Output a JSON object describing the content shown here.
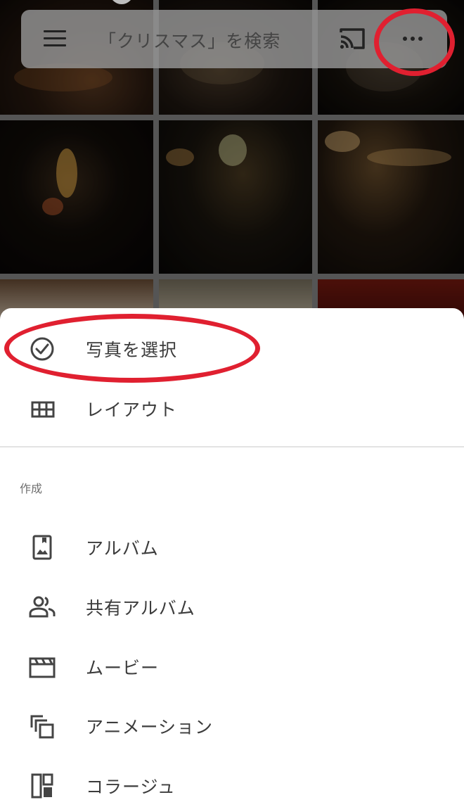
{
  "search": {
    "text": "「クリスマス」を検索"
  },
  "icons": {
    "menu": "menu-icon",
    "cast": "cast-icon",
    "more": "more-horizontal-icon"
  },
  "menu_sheet": {
    "items_top": [
      {
        "label": "写真を選択",
        "icon": "check-circle-icon"
      },
      {
        "label": "レイアウト",
        "icon": "grid-icon"
      }
    ],
    "section_title": "作成",
    "create_items": [
      {
        "label": "アルバム",
        "icon": "album-icon"
      },
      {
        "label": "共有アルバム",
        "icon": "shared-album-icon"
      },
      {
        "label": "ムービー",
        "icon": "movie-icon"
      },
      {
        "label": "アニメーション",
        "icon": "animation-icon"
      },
      {
        "label": "コラージュ",
        "icon": "collage-icon"
      }
    ]
  },
  "colors": {
    "highlight_ring": "#e02030",
    "sheet_bg": "#ffffff",
    "text": "#3c3c3c"
  }
}
